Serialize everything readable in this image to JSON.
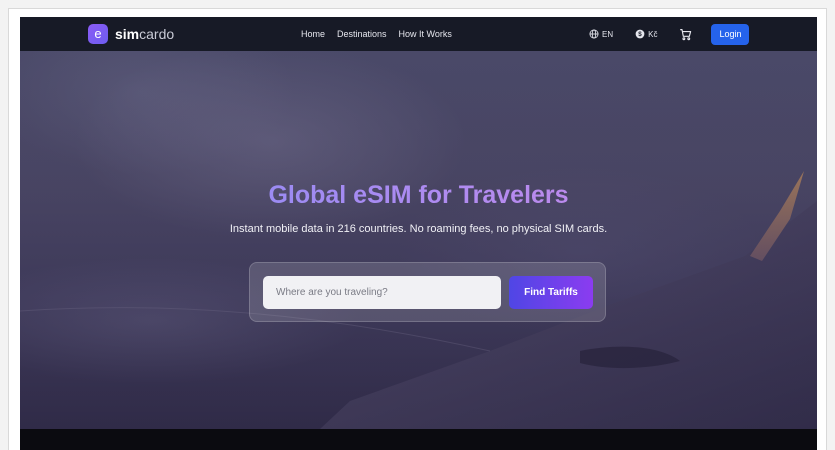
{
  "brand": {
    "mark": "e",
    "name_bold": "sim",
    "name_rest": "cardo"
  },
  "nav": {
    "links": [
      {
        "label": "Home"
      },
      {
        "label": "Destinations"
      },
      {
        "label": "How It Works"
      }
    ],
    "language": {
      "label": "EN",
      "icon": "globe-icon"
    },
    "currency": {
      "label": "Kč",
      "icon": "currency-icon"
    },
    "cart_icon": "cart-icon",
    "login_label": "Login"
  },
  "hero": {
    "title": "Global eSIM for Travelers",
    "subtitle": "Instant mobile data in 216 countries. No roaming fees, no physical SIM cards.",
    "search": {
      "placeholder": "Where are you traveling?",
      "value": "",
      "button_label": "Find Tariffs"
    }
  },
  "colors": {
    "nav_bg": "#171a26",
    "login_bg": "#2563eb",
    "cta_gradient_start": "#4f46e5",
    "cta_gradient_end": "#8b3cf0",
    "title_gradient_start": "#7f8cf5",
    "title_gradient_end": "#d58ae8"
  }
}
